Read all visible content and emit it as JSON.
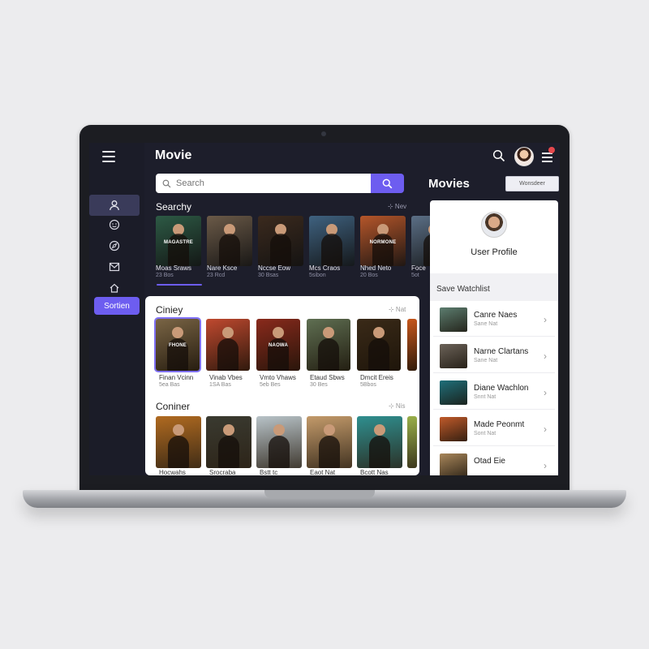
{
  "app": {
    "title": "Movie"
  },
  "search": {
    "placeholder": "Search"
  },
  "sidebar": {
    "icons": [
      "user-icon",
      "emoji-icon",
      "compass-icon",
      "mail-icon",
      "home-icon"
    ],
    "button_label": "Sortien"
  },
  "searchy": {
    "title": "Searchy",
    "more": "⊹ Nev",
    "items": [
      {
        "title": "Moas Sraws",
        "sub": "23 Bos",
        "poster_text": "MAGASTRE",
        "color": "#2d5a45"
      },
      {
        "title": "Nare Ksce",
        "sub": "23 Rcd",
        "poster_text": "",
        "color": "#6b5a48"
      },
      {
        "title": "Nccse Eow",
        "sub": "30 Bsas",
        "poster_text": "",
        "color": "#3b2a1e"
      },
      {
        "title": "Mcs Craos",
        "sub": "5sibon",
        "poster_text": "",
        "color": "#3f6280"
      },
      {
        "title": "Nhed Neto",
        "sub": "20 Bos",
        "poster_text": "NORMONE",
        "color": "#b5562a"
      },
      {
        "title": "Foce",
        "sub": "5ot",
        "poster_text": "",
        "color": "#5b6f86"
      }
    ]
  },
  "ciniey": {
    "title": "Ciniey",
    "more": "⊹ Nat",
    "items": [
      {
        "title": "Finan Vcinn",
        "sub": "5ea Bas",
        "poster_text": "FHONE",
        "color": "#7a6545"
      },
      {
        "title": "Vinab Vbes",
        "sub": "1SA Bas",
        "poster_text": "",
        "color": "#c0492f"
      },
      {
        "title": "Vmto Vhaws",
        "sub": "5eb Bes",
        "poster_text": "NAOWA",
        "color": "#8a2a1c"
      },
      {
        "title": "Etaud Sbws",
        "sub": "30 Bes",
        "poster_text": "",
        "color": "#5f6f52"
      },
      {
        "title": "Dmcit Ereis",
        "sub": "5Bbos",
        "poster_text": "",
        "color": "#3a2a18"
      },
      {
        "title": "",
        "sub": "",
        "poster_text": "",
        "color": "#c8571c"
      }
    ]
  },
  "coniner": {
    "title": "Coniner",
    "more": "⊹ Nis",
    "items": [
      {
        "color": "#b06a20"
      },
      {
        "color": "#3a3a30"
      },
      {
        "color": "#b8c3c8"
      },
      {
        "color": "#c39a6a"
      },
      {
        "color": "#2f8f8f"
      },
      {
        "color": "#9ab04a"
      }
    ],
    "captions": [
      "Hocwahs",
      "Srocraba",
      "Bstt tc",
      "Eaot Nat",
      "Bcott Nas",
      ""
    ]
  },
  "right": {
    "movies_title": "Movies",
    "watchlist_button": "Wonsdeer",
    "profile_name": "User Profile",
    "save_watchlist": "Save Watchlist",
    "items": [
      {
        "title": "Canre Naes",
        "sub": "Sane Nat",
        "color": "#5c7d6f"
      },
      {
        "title": "Narne Clartans",
        "sub": "Sane Nat",
        "color": "#6b6258"
      },
      {
        "title": "Diane Wachlon",
        "sub": "Snnt Nat",
        "color": "#1f6f7a"
      },
      {
        "title": "Made Peonmt",
        "sub": "Sont Nat",
        "color": "#c05a2a"
      },
      {
        "title": "Otad Eie",
        "sub": "",
        "color": "#a8865a"
      }
    ]
  },
  "colors": {
    "accent": "#6d5df0",
    "screen_bg": "#1d1e2b",
    "panel_bg": "#ffffff"
  }
}
